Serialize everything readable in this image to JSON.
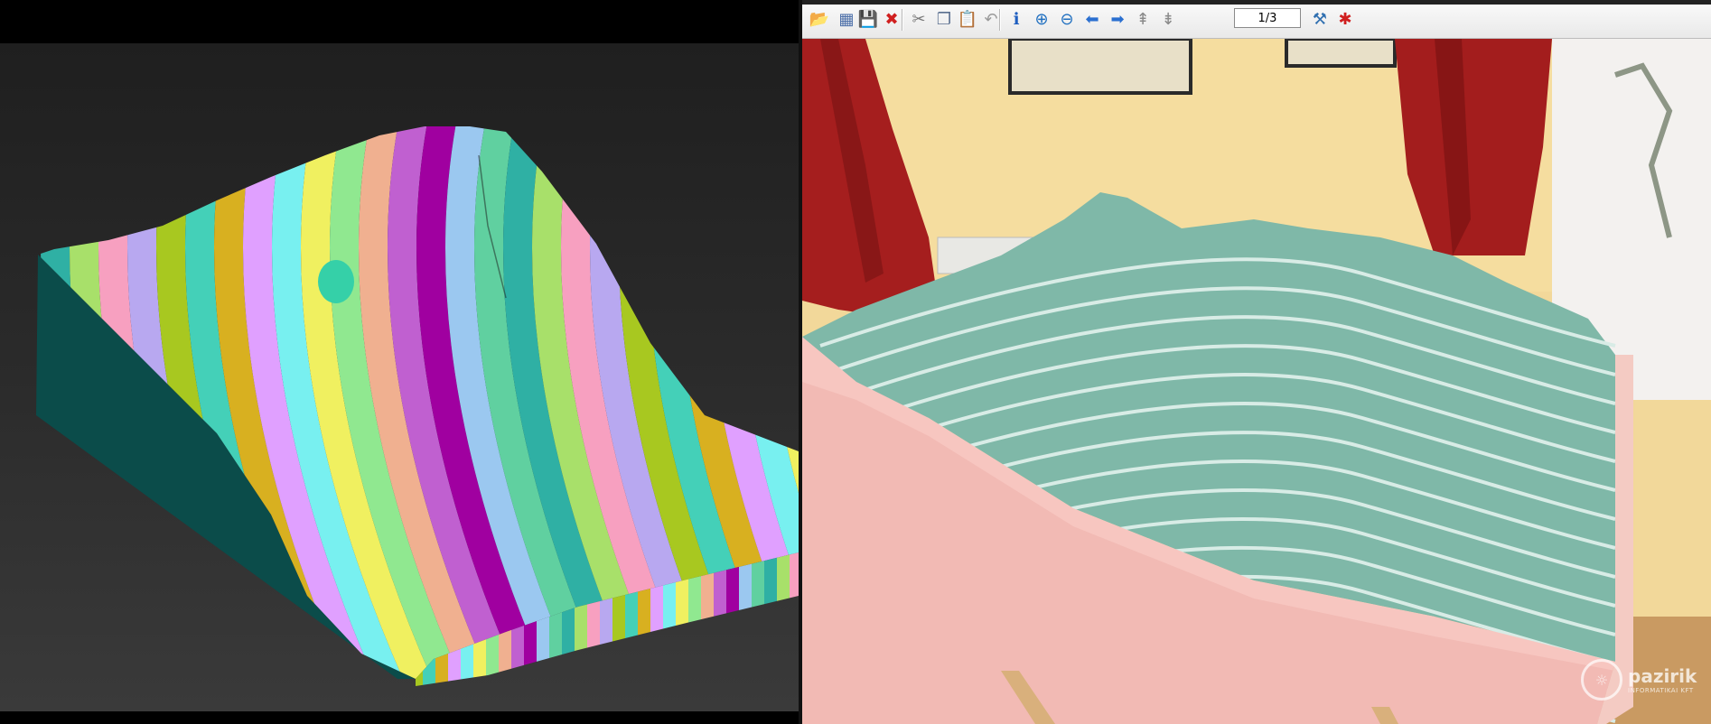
{
  "viewer": {
    "page_indicator": "1/3",
    "toolbar": [
      {
        "name": "open-icon",
        "glyph": "📂",
        "color": "#d89b1c"
      },
      {
        "name": "thumbnails-icon",
        "glyph": "▦",
        "color": "#4b6ea8"
      },
      {
        "name": "save-icon",
        "glyph": "💾",
        "color": "#2a5fa8"
      },
      {
        "name": "delete-icon",
        "glyph": "✖",
        "color": "#d01f1f"
      },
      {
        "name": "cut-icon",
        "glyph": "✂",
        "color": "#7a7a7a"
      },
      {
        "name": "copy-icon",
        "glyph": "❐",
        "color": "#5a6f8f"
      },
      {
        "name": "paste-icon",
        "glyph": "📋",
        "color": "#b88a2a"
      },
      {
        "name": "undo-icon",
        "glyph": "↶",
        "color": "#9a9a9a"
      },
      {
        "name": "info-icon",
        "glyph": "ℹ",
        "color": "#1f5fc0"
      },
      {
        "name": "zoom-in-icon",
        "glyph": "⊕",
        "color": "#1f6fc0"
      },
      {
        "name": "zoom-out-icon",
        "glyph": "⊖",
        "color": "#1f6fc0"
      },
      {
        "name": "previous-icon",
        "glyph": "⬅",
        "color": "#2a6fd0"
      },
      {
        "name": "next-icon",
        "glyph": "➡",
        "color": "#2a6fd0"
      },
      {
        "name": "first-page-icon",
        "glyph": "⇞",
        "color": "#8a8a8a"
      },
      {
        "name": "last-page-icon",
        "glyph": "⇟",
        "color": "#8a8a8a"
      },
      {
        "name": "settings-icon",
        "glyph": "⚒",
        "color": "#2f6fb0"
      },
      {
        "name": "exit-icon",
        "glyph": "✱",
        "color": "#d01f1f"
      }
    ],
    "watermark": {
      "brand": "pazirik",
      "tagline": "INFORMATIKAI KFT"
    }
  },
  "model_stripe_colors": [
    "#2fb0a4",
    "#a8e06a",
    "#f7a0c0",
    "#b8a8f0",
    "#a8c820",
    "#44d0b8",
    "#d8b020",
    "#e0a0ff",
    "#78f0f0",
    "#f0f060",
    "#90e890",
    "#f0b090",
    "#c060d0",
    "#a000a0",
    "#9bc8f0",
    "#60d0a0"
  ]
}
